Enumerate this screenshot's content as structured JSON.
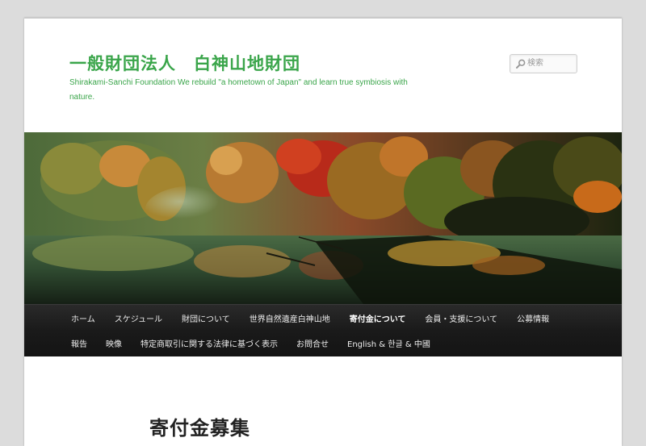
{
  "header": {
    "site_title": "一般財団法人　白神山地財団",
    "site_description": "Shirakami-Sanchi Foundation We rebuild \"a hometown of Japan\" and learn true symbiosis with nature."
  },
  "search": {
    "placeholder": "検索",
    "icon": "search-icon"
  },
  "nav": {
    "row1": [
      "ホーム",
      "スケジュール",
      "財団について",
      "世界自然遺産白神山地",
      "寄付金について",
      "会員・支援について",
      "公募情報"
    ],
    "row2": [
      "報告",
      "映像",
      "特定商取引に関する法律に基づく表示",
      "お問合せ",
      "English & 한글 & 中國"
    ],
    "active": "寄付金について"
  },
  "main": {
    "entry_title": "寄付金募集"
  },
  "colors": {
    "brand_green": "#3aa54a",
    "nav_background": "#1a1a1a",
    "page_background": "#dcdcdc"
  }
}
